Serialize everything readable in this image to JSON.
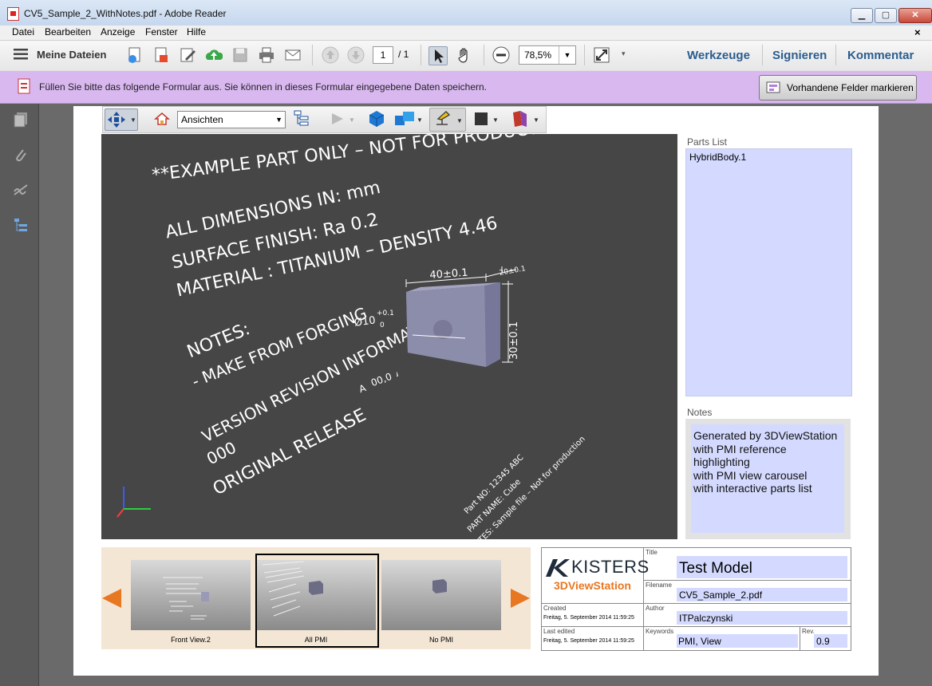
{
  "window": {
    "title": "CV5_Sample_2_WithNotes.pdf - Adobe Reader",
    "min": "▁",
    "max": "▢",
    "close": "✕"
  },
  "menu": [
    "Datei",
    "Bearbeiten",
    "Anzeige",
    "Fenster",
    "Hilfe"
  ],
  "menu_close": "×",
  "toolbar": {
    "my_files": "Meine Dateien",
    "page_current": "1",
    "page_total": "/ 1",
    "zoom": "78,5%",
    "tools": "Werkzeuge",
    "sign": "Signieren",
    "comment": "Kommentar"
  },
  "formbar": {
    "message": "Füllen Sie bitte das folgende Formular aus. Sie können in dieses Formular eingegebene Daten speichern.",
    "highlight_button": "Vorhandene Felder markieren"
  },
  "toolbar3d": {
    "views": "Ansichten"
  },
  "viewport": {
    "line1": "**EXAMPLE PART ONLY – NOT FOR PRODUCTION**",
    "line2": "ALL DIMENSIONS IN: mm",
    "line3": "SURFACE FINISH: Ra 0.2",
    "line4": "MATERIAL : TITANIUM – DENSITY 4.46",
    "line5": "NOTES:",
    "line6": "- MAKE FROM FORGING",
    "line7": "VERSION REVISION INFORMATION",
    "line8": "000",
    "line9": "ORIGINAL RELEASE",
    "dim_width": "40±0.1",
    "dim_depth": "20±0.1",
    "dim_height": "30±0.1",
    "dim_hole": "Ø10",
    "dim_hole_tol_up": "+0.1",
    "dim_hole_tol_low": "0",
    "gdt_a": "A",
    "gdt_val": "00,0",
    "part_no": "Part NO: 12345 ABC",
    "part_name": "PART NAME: Cube",
    "part_notes": "NOTES: Sample file – Not for production"
  },
  "parts_list": {
    "label": "Parts List",
    "items": [
      "HybridBody.1"
    ]
  },
  "notes": {
    "label": "Notes",
    "lines": [
      "Generated by 3DViewStation",
      "with PMI reference",
      "highlighting",
      "with PMI view carousel",
      "with interactive parts list"
    ]
  },
  "carousel": {
    "views": [
      {
        "label": "Front View.2"
      },
      {
        "label": "All PMI"
      },
      {
        "label": "No PMI"
      }
    ]
  },
  "title_block": {
    "brand": "KISTERS",
    "brand_sub": "3DViewStation",
    "title_label": "Title",
    "title": "Test Model",
    "filename_label": "Filename",
    "filename": "CV5_Sample_2.pdf",
    "created_label": "Created",
    "created": "Freitag, 5. September 2014 11:59:25",
    "author_label": "Author",
    "author": "ITPalczynski",
    "last_edited_label": "Last edited",
    "last_edited": "Freitag, 5. September 2014 11:59:25",
    "keywords_label": "Keywords",
    "keywords": "PMI, View",
    "rev_label": "Rev.",
    "rev": "0.9"
  },
  "colors": {
    "formbar": "#d9b8f0",
    "field": "#d4daff",
    "link": "#2a5d8f",
    "arrow": "#e87722",
    "viewport": "#464646"
  }
}
